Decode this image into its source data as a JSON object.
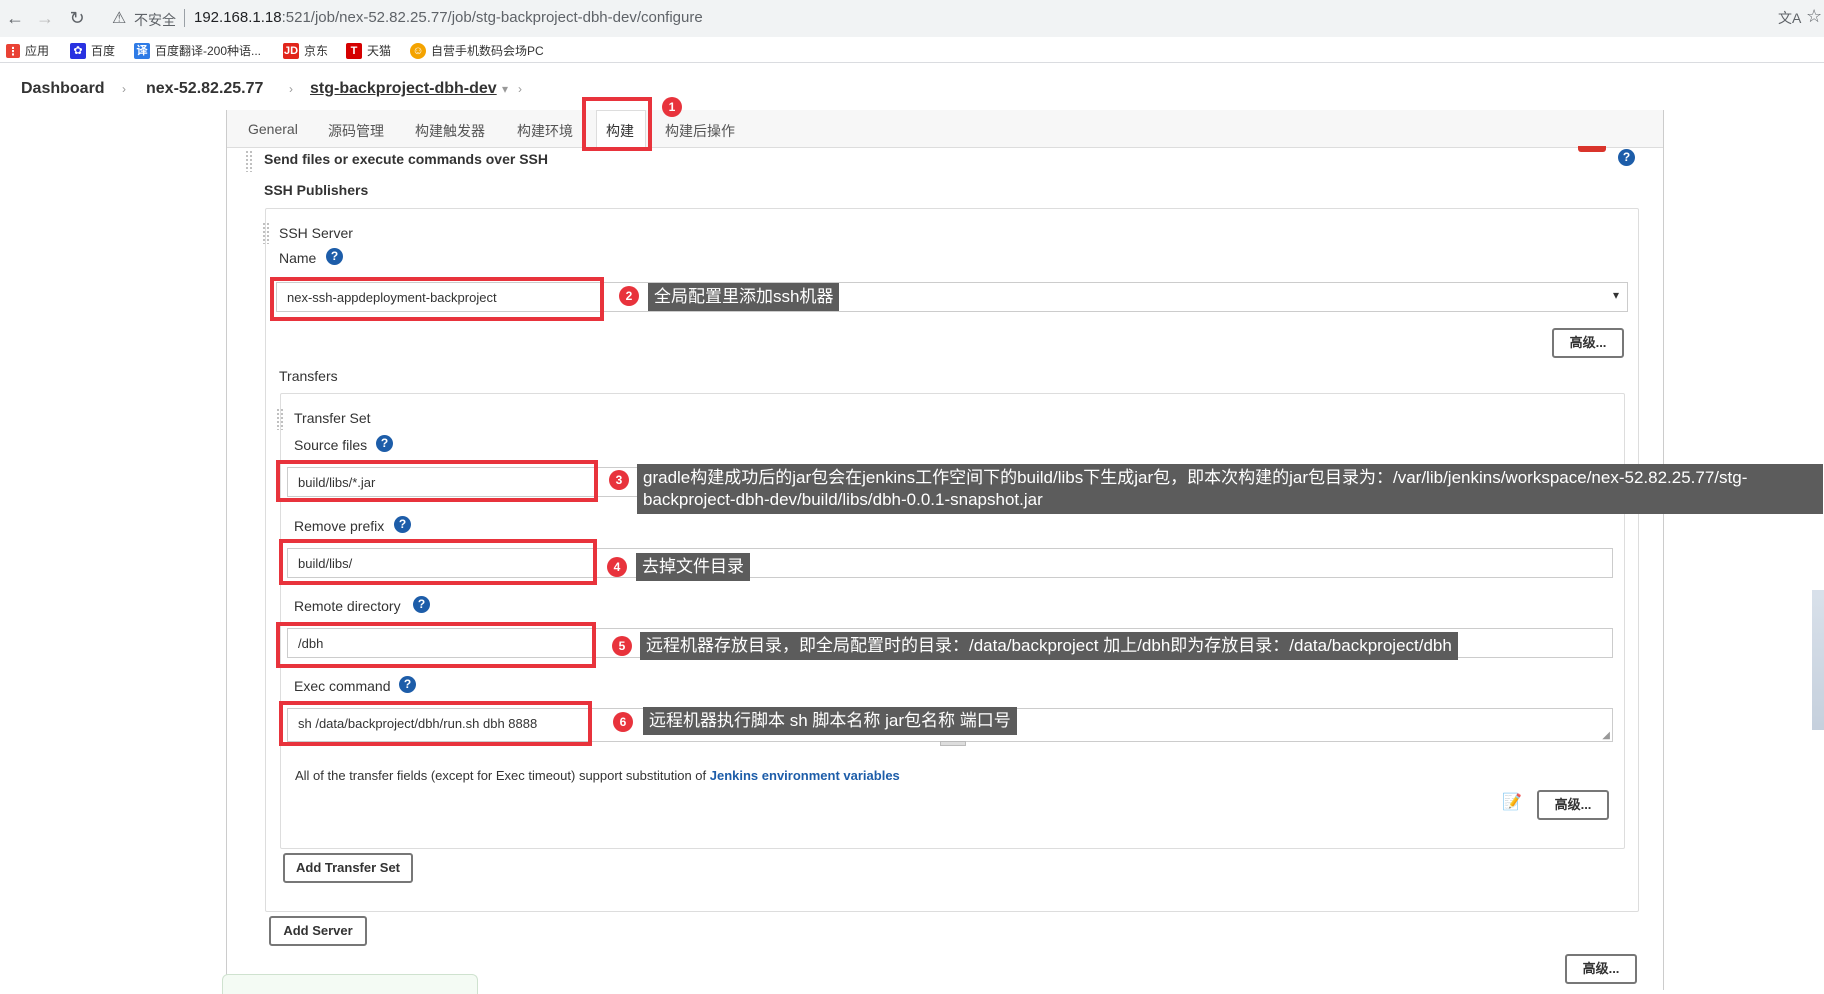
{
  "browser": {
    "insecure_label": "不安全",
    "url_host": "192.168.1.18",
    "url_path": ":521/job/nex-52.82.25.77/job/stg-backproject-dbh-dev/configure",
    "bookmarks": [
      {
        "label": "应用",
        "icon": "apps-grid-icon",
        "color": "#e94235"
      },
      {
        "label": "百度",
        "icon": "baidu-paw-icon",
        "color": "#2932e1"
      },
      {
        "label": "百度翻译-200种语...",
        "icon": "translate-icon",
        "color": "#2e7be6"
      },
      {
        "label": "京东",
        "icon": "jd-logo-icon",
        "color": "#e1251b"
      },
      {
        "label": "天猫",
        "icon": "tmall-logo-icon",
        "color": "#d50000"
      },
      {
        "label": "自营手机数码会场PC",
        "icon": "store-icon",
        "color": "#f4a300"
      }
    ]
  },
  "breadcrumb": {
    "items": [
      "Dashboard",
      "nex-52.82.25.77",
      "stg-backproject-dbh-dev"
    ]
  },
  "tabs": [
    "General",
    "源码管理",
    "构建触发器",
    "构建环境",
    "构建",
    "构建后操作"
  ],
  "active_tab": "构建",
  "ssh": {
    "section_title": "Send files or execute commands over SSH",
    "publishers_title": "SSH Publishers",
    "server_title": "SSH Server",
    "name_label": "Name",
    "name_value": "nex-ssh-appdeployment-backproject",
    "advanced_label": "高级...",
    "transfers_label": "Transfers",
    "transfer_set_title": "Transfer Set",
    "source_files_label": "Source files",
    "source_files_value": "build/libs/*.jar",
    "remove_prefix_label": "Remove prefix",
    "remove_prefix_value": "build/libs/",
    "remote_dir_label": "Remote directory",
    "remote_dir_value": "/dbh",
    "exec_label": "Exec command",
    "exec_value": "sh /data/backproject/dbh/run.sh dbh 8888",
    "note_text": "All of the transfer fields (except for Exec timeout) support substitution of ",
    "note_link": "Jenkins environment variables",
    "add_transfer_set": "Add Transfer Set",
    "add_server": "Add Server"
  },
  "annotations": {
    "badges": [
      "1",
      "2",
      "3",
      "4",
      "5",
      "6"
    ],
    "callout_2": "全局配置里添加ssh机器",
    "callout_3_line1": "gradle构建成功后的jar包会在jenkins工作空间下的build/libs下生成jar包，即本次构建的jar包目录为：/var/lib/jenkins/workspace/nex-52.82.25.77/stg-",
    "callout_3_line2": "backproject-dbh-dev/build/libs/dbh-0.0.1-snapshot.jar",
    "callout_4": "去掉文件目录",
    "callout_5": "远程机器存放目录，即全局配置时的目录：/data/backproject 加上/dbh即为存放目录：/data/backproject/dbh",
    "callout_6": "远程机器执行脚本 sh 脚本名称 jar包名称 端口号"
  },
  "colors": {
    "annotation_red": "#e8333c",
    "help_blue": "#1d5da9",
    "callout_gray": "#5c5c5c"
  }
}
